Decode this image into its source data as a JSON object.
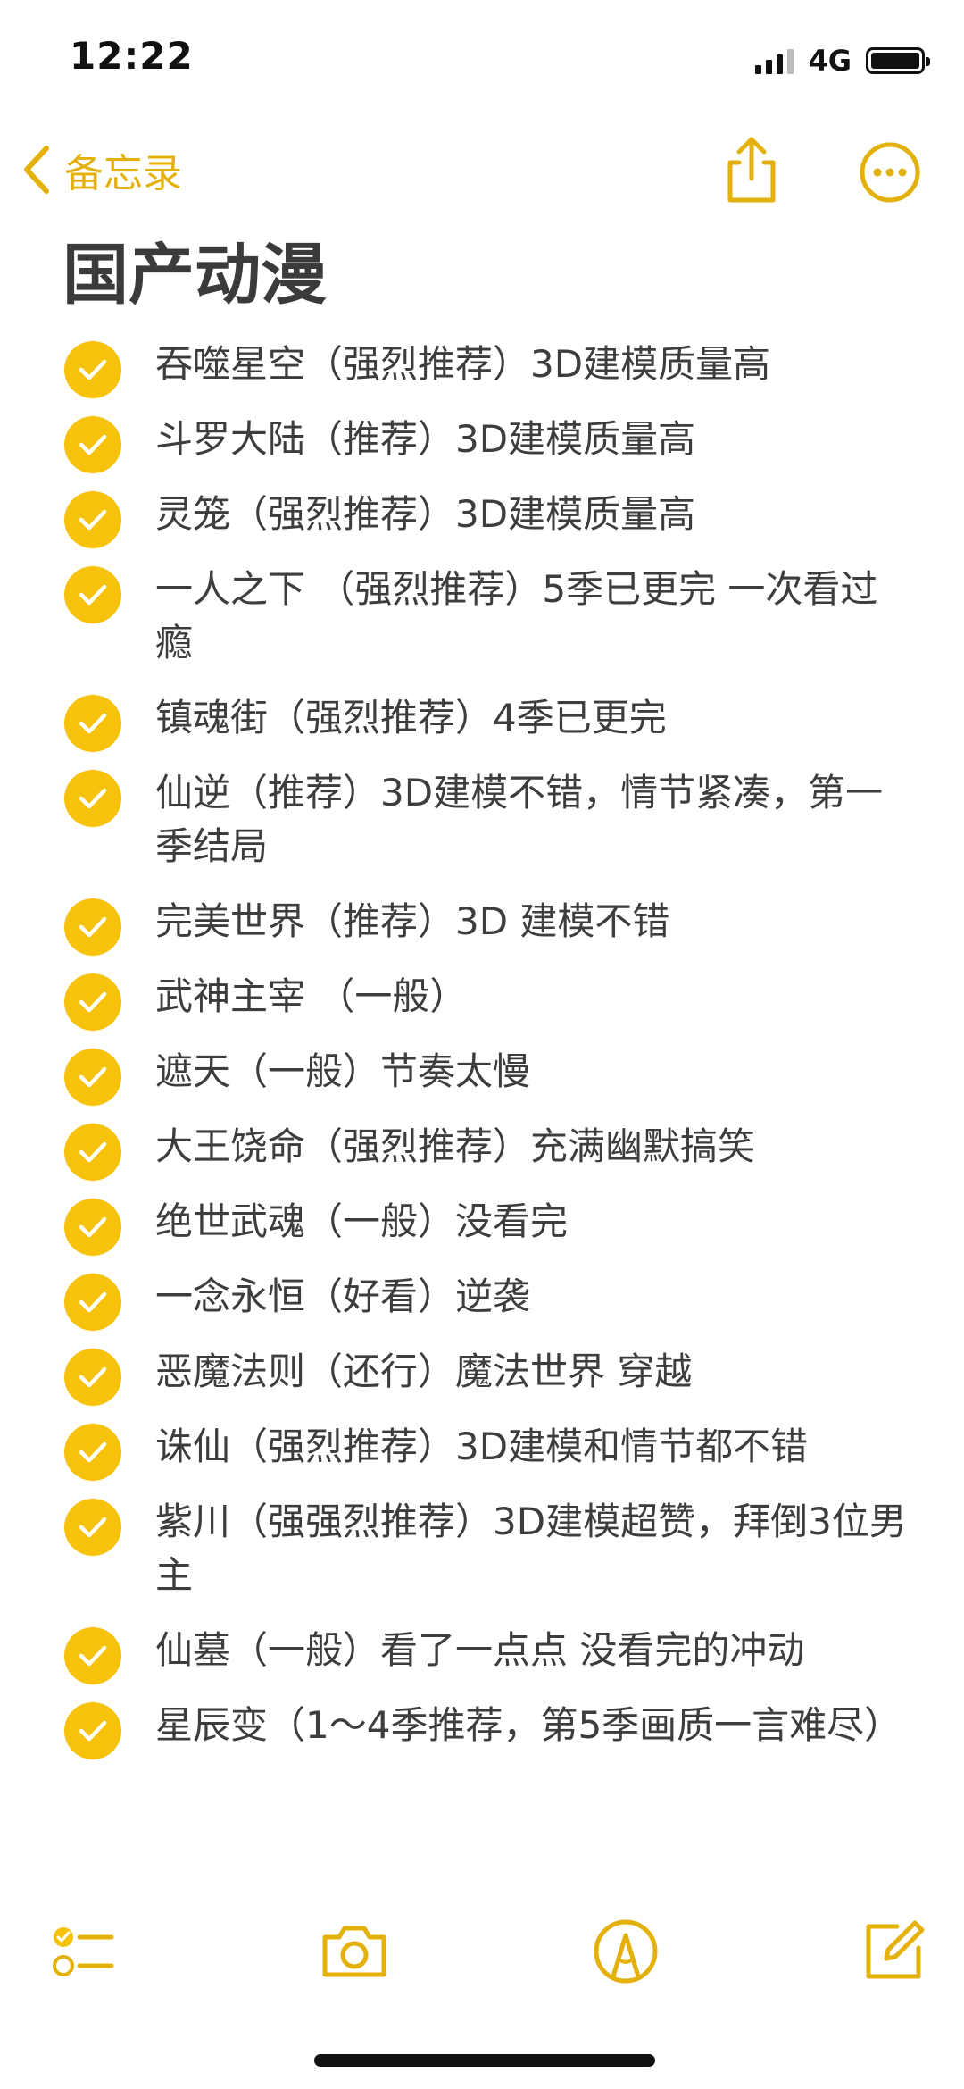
{
  "status_bar": {
    "time": "12:22",
    "network": "4G",
    "signal_icon": "signal-bars-icon",
    "battery_icon": "battery-full-icon"
  },
  "nav": {
    "back_label": "备忘录",
    "back_icon": "chevron-left-icon",
    "share_icon": "share-icon",
    "more_icon": "ellipsis-circle-icon"
  },
  "note": {
    "title": "国产动漫",
    "items": [
      {
        "text": "吞噬星空（强烈推荐）3D建模质量高",
        "checked": true
      },
      {
        "text": "斗罗大陆（推荐）3D建模质量高",
        "checked": true
      },
      {
        "text": "灵笼（强烈推荐）3D建模质量高",
        "checked": true
      },
      {
        "text": "一人之下 （强烈推荐）5季已更完 一次看过瘾",
        "checked": true
      },
      {
        "text": "镇魂街（强烈推荐）4季已更完",
        "checked": true
      },
      {
        "text": "仙逆（推荐）3D建模不错，情节紧凑，第一季结局",
        "checked": true
      },
      {
        "text": "完美世界（推荐）3D 建模不错",
        "checked": true
      },
      {
        "text": "武神主宰 （一般）",
        "checked": true
      },
      {
        "text": "遮天（一般）节奏太慢",
        "checked": true
      },
      {
        "text": "大王饶命（强烈推荐）充满幽默搞笑",
        "checked": true
      },
      {
        "text": "绝世武魂（一般）没看完",
        "checked": true
      },
      {
        "text": "一念永恒（好看）逆袭",
        "checked": true
      },
      {
        "text": "恶魔法则（还行）魔法世界 穿越",
        "checked": true
      },
      {
        "text": "诛仙（强烈推荐）3D建模和情节都不错",
        "checked": true
      },
      {
        "text": "紫川（强强烈推荐）3D建模超赞，拜倒3位男主",
        "checked": true
      },
      {
        "text": "仙墓（一般）看了一点点 没看完的冲动",
        "checked": true
      },
      {
        "text": "星辰变（1～4季推荐，第5季画质一言难尽）",
        "checked": true
      }
    ]
  },
  "toolbar": {
    "checklist_icon": "checklist-icon",
    "camera_icon": "camera-icon",
    "markup_icon": "markup-pen-icon",
    "compose_icon": "compose-icon"
  },
  "colors": {
    "accent": "#e3b10a",
    "check_fill": "#f7c20c",
    "text": "#3d3d3d",
    "background": "#ffffff"
  }
}
